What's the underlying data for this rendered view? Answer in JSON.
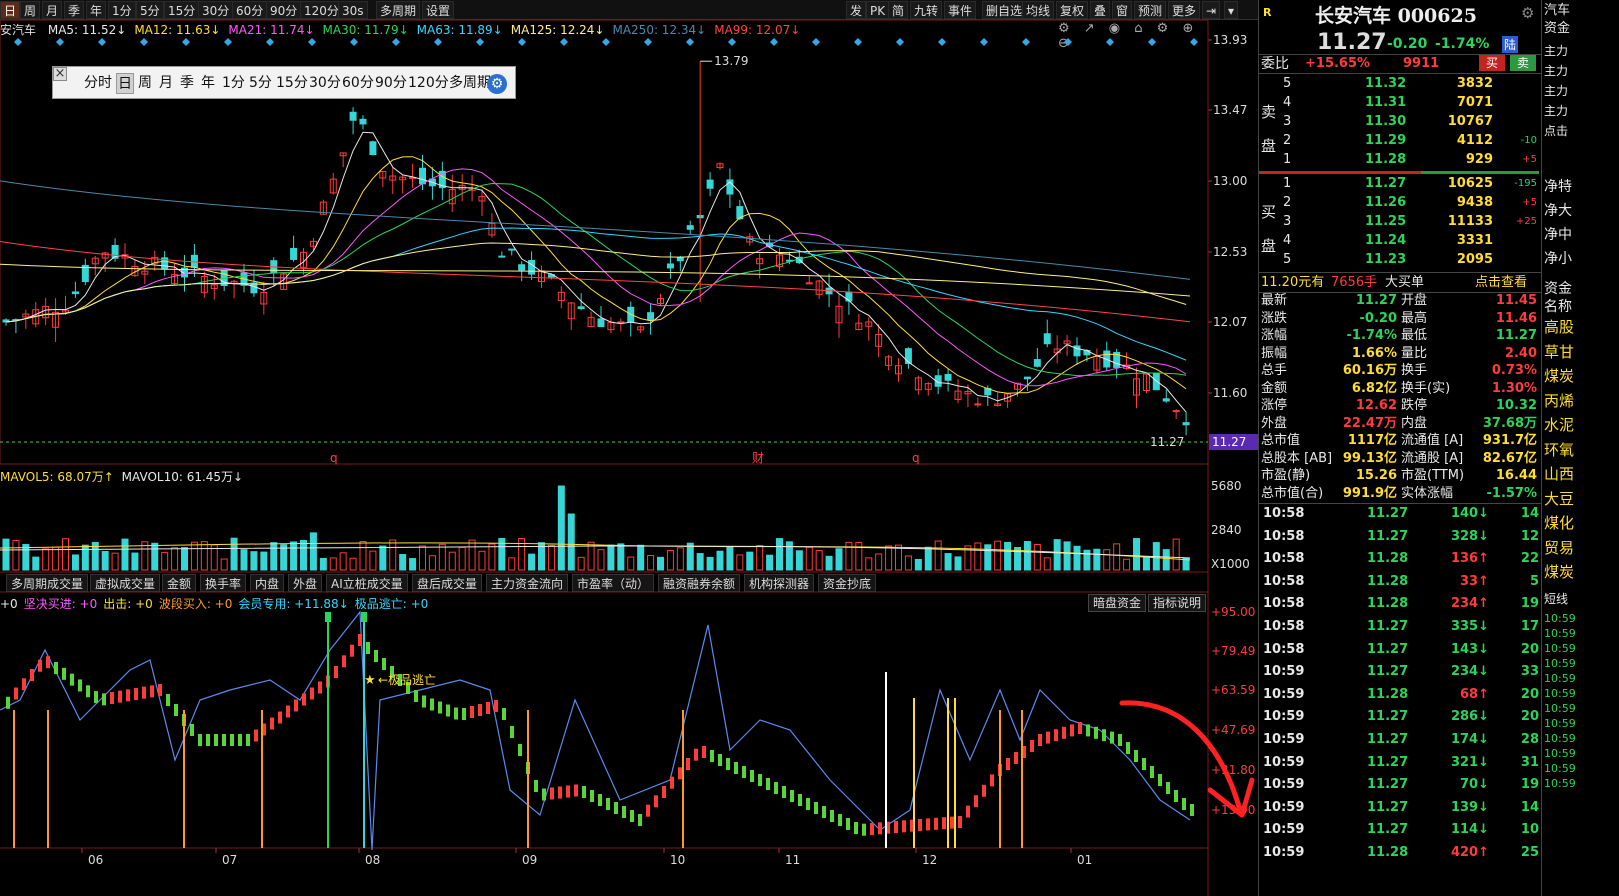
{
  "toolbar": {
    "periods": [
      "日",
      "周",
      "月",
      "季",
      "年",
      "1分",
      "5分",
      "15分",
      "30分",
      "60分",
      "90分",
      "120分",
      "30s",
      "多周期",
      "设置"
    ],
    "active_index": 0,
    "right_buttons": [
      "发",
      "PK",
      "简",
      "九转",
      "事件",
      "删自选",
      "均线",
      "复权",
      "叠",
      "窗",
      "预测",
      "更多"
    ]
  },
  "ma_line": {
    "prefix": "安汽车",
    "items": [
      {
        "text": "MA5: 11.52↓",
        "color": "#e8e8e8"
      },
      {
        "text": "MA12: 11.63↓",
        "color": "#ffdd33"
      },
      {
        "text": "MA21: 11.74↓",
        "color": "#ff55ff"
      },
      {
        "text": "MA30: 11.79↓",
        "color": "#2bd45a"
      },
      {
        "text": "MA63: 11.89↓",
        "color": "#36d6ff"
      },
      {
        "text": "MA125: 12.24↓",
        "color": "#ffee88"
      },
      {
        "text": "MA250: 12.34↓",
        "color": "#4a8aaa"
      },
      {
        "text": "MA99: 12.07↓",
        "color": "#ff4444"
      }
    ]
  },
  "period_popup": {
    "items": [
      "分时",
      "日",
      "周",
      "月",
      "季",
      "年",
      "1分",
      "5分",
      "15分",
      "30分",
      "60分",
      "90分",
      "120分",
      "多周期"
    ],
    "selected": "日"
  },
  "kline_annotations": {
    "high_label": "13.79",
    "last_label": "11.27",
    "markers": [
      "q",
      "财",
      "q"
    ]
  },
  "price_axis": [
    "13.93",
    "13.47",
    "13.00",
    "12.53",
    "12.07",
    "11.60",
    "11.27"
  ],
  "volume": {
    "label1": "MAVOL5: 68.07万↑",
    "label2": "MAVOL10: 61.45万↓",
    "axis": [
      "5680",
      "2840",
      "X1000"
    ]
  },
  "indicator_tabs": [
    "多周期成交量",
    "虚拟成交量",
    "金额",
    "换手率",
    "内盘",
    "外盘",
    "AI立桩成交量",
    "盘后成交量",
    "主力资金流向",
    "市盈率（动）",
    "融资融券余额",
    "机构探测器",
    "资金抄底"
  ],
  "indicator": {
    "legend": [
      {
        "text": "+0",
        "color": "#e8e8e8"
      },
      {
        "text": "坚决买进: +0",
        "color": "#ff55ff"
      },
      {
        "text": "出击: +0",
        "color": "#ffdd33"
      },
      {
        "text": "波段买入: +0",
        "color": "#ff9922"
      },
      {
        "text": "会员专用: +11.88↓",
        "color": "#36d6ff"
      },
      {
        "text": "极品逃亡: +0",
        "color": "#36d6ff"
      }
    ],
    "buttons": [
      "暗盘资金",
      "指标说明"
    ],
    "escape_label": "极品逃亡",
    "axis": [
      "+95.00",
      "+79.49",
      "+63.59",
      "+47.69",
      "+31.80",
      "+15.90"
    ]
  },
  "dates": [
    "06",
    "07",
    "08",
    "09",
    "10",
    "11",
    "12",
    "01"
  ],
  "quote": {
    "title": "长安汽车 000625",
    "price": "11.27",
    "change": "-0.20",
    "pct": "-1.74%",
    "tag": "陆",
    "webi_label": "委比",
    "webi": "+15.65%",
    "webi_diff": "9911",
    "buy_btn": "买",
    "sell_btn": "卖",
    "sell_label": [
      "卖",
      "盘"
    ],
    "buy_label": [
      "买",
      "盘"
    ],
    "asks": [
      {
        "lv": "5",
        "price": "11.32",
        "vol": "3832",
        "chg": ""
      },
      {
        "lv": "4",
        "price": "11.31",
        "vol": "7071",
        "chg": ""
      },
      {
        "lv": "3",
        "price": "11.30",
        "vol": "10767",
        "chg": ""
      },
      {
        "lv": "2",
        "price": "11.29",
        "vol": "4112",
        "chg": "-10"
      },
      {
        "lv": "1",
        "price": "11.28",
        "vol": "929",
        "chg": "+5"
      }
    ],
    "bids": [
      {
        "lv": "1",
        "price": "11.27",
        "vol": "10625",
        "chg": "-195"
      },
      {
        "lv": "2",
        "price": "11.26",
        "vol": "9438",
        "chg": "+5"
      },
      {
        "lv": "3",
        "price": "11.25",
        "vol": "11133",
        "chg": "+25"
      },
      {
        "lv": "4",
        "price": "11.24",
        "vol": "3331",
        "chg": ""
      },
      {
        "lv": "5",
        "price": "11.23",
        "vol": "2095",
        "chg": ""
      }
    ],
    "big_order": {
      "left": "11.20元有",
      "mid": "7656手",
      "right": "大买单",
      "link": "点击查看"
    },
    "stats": [
      [
        "最新",
        "11.27",
        "开盘",
        "11.45"
      ],
      [
        "涨跌",
        "-0.20",
        "最高",
        "11.46"
      ],
      [
        "涨幅",
        "-1.74%",
        "最低",
        "11.27"
      ],
      [
        "振幅",
        "1.66%",
        "量比",
        "2.40"
      ],
      [
        "总手",
        "60.16万",
        "换手",
        "0.73%"
      ],
      [
        "金额",
        "6.82亿",
        "换手(实)",
        "1.30%"
      ],
      [
        "涨停",
        "12.62",
        "跌停",
        "10.32"
      ],
      [
        "外盘",
        "22.47万",
        "内盘",
        "37.68万"
      ],
      [
        "总市值",
        "1117亿",
        "流通值 [A]",
        "931.7亿"
      ],
      [
        "总股本 [AB]",
        "99.13亿",
        "流通股 [A]",
        "82.67亿"
      ],
      [
        "市盈(静)",
        "15.26",
        "市盈(TTM)",
        "16.44"
      ],
      [
        "总市值(合)",
        "991.9亿",
        "实体涨幅",
        "-1.57%"
      ]
    ],
    "ticks": [
      {
        "time": "10:58",
        "price": "11.27",
        "vol": "140",
        "dir": "down",
        "n": "14"
      },
      {
        "time": "10:58",
        "price": "11.27",
        "vol": "328",
        "dir": "down",
        "n": "12"
      },
      {
        "time": "10:58",
        "price": "11.28",
        "vol": "136",
        "dir": "up",
        "n": "22"
      },
      {
        "time": "10:58",
        "price": "11.28",
        "vol": "33",
        "dir": "up",
        "n": "5"
      },
      {
        "time": "10:58",
        "price": "11.28",
        "vol": "234",
        "dir": "up",
        "n": "19"
      },
      {
        "time": "10:58",
        "price": "11.27",
        "vol": "335",
        "dir": "down",
        "n": "17"
      },
      {
        "time": "10:58",
        "price": "11.27",
        "vol": "143",
        "dir": "down",
        "n": "20"
      },
      {
        "time": "10:59",
        "price": "11.27",
        "vol": "234",
        "dir": "down",
        "n": "33"
      },
      {
        "time": "10:59",
        "price": "11.28",
        "vol": "68",
        "dir": "up",
        "n": "20"
      },
      {
        "time": "10:59",
        "price": "11.27",
        "vol": "286",
        "dir": "down",
        "n": "20"
      },
      {
        "time": "10:59",
        "price": "11.27",
        "vol": "174",
        "dir": "down",
        "n": "28"
      },
      {
        "time": "10:59",
        "price": "11.27",
        "vol": "321",
        "dir": "down",
        "n": "31"
      },
      {
        "time": "10:59",
        "price": "11.27",
        "vol": "70",
        "dir": "down",
        "n": "19"
      },
      {
        "time": "10:59",
        "price": "11.27",
        "vol": "139",
        "dir": "down",
        "n": "14"
      },
      {
        "time": "10:59",
        "price": "11.27",
        "vol": "114",
        "dir": "down",
        "n": "10"
      },
      {
        "time": "10:59",
        "price": "11.28",
        "vol": "420",
        "dir": "up",
        "n": "25"
      }
    ]
  },
  "far_right": {
    "top": [
      "汽车",
      "资金"
    ],
    "items": [
      "主力",
      "主力",
      "主力",
      "主力",
      "点击"
    ],
    "flow": [
      "净特",
      "净大",
      "净中",
      "净小"
    ],
    "list_header": [
      "资金",
      "名称"
    ],
    "sectors": [
      "高股",
      "草甘",
      "煤炭",
      "丙烯",
      "水泥",
      "环氧",
      "山西",
      "大豆",
      "煤化",
      "贸易",
      "煤炭"
    ],
    "short_label": "短线",
    "times": [
      "10:59",
      "10:59",
      "10:59",
      "10:59",
      "10:59",
      "10:59",
      "10:59",
      "10:59",
      "10:59",
      "10:59",
      "10:59",
      "10:59"
    ]
  },
  "colors": {
    "up": "#ff3b3b",
    "down": "#2bd45a",
    "cyan": "#36d6d6",
    "bg": "#000000"
  }
}
